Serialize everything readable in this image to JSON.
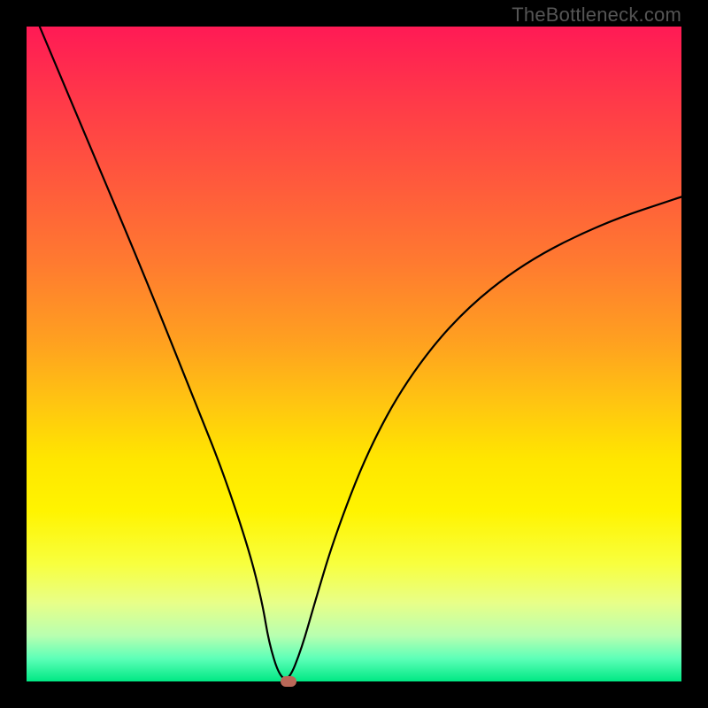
{
  "watermark": "TheBottleneck.com",
  "chart_data": {
    "type": "line",
    "title": "",
    "xlabel": "",
    "ylabel": "",
    "xlim": [
      0,
      100
    ],
    "ylim": [
      0,
      100
    ],
    "series": [
      {
        "name": "curve",
        "x": [
          2,
          10,
          18,
          26,
          30,
          34,
          36,
          37,
          38.5,
          40,
          42,
          44,
          47,
          52,
          58,
          66,
          76,
          88,
          100
        ],
        "values": [
          100,
          81,
          62,
          42,
          32,
          20,
          12,
          6,
          1,
          0,
          5,
          12,
          22,
          35,
          46,
          56,
          64,
          70,
          74
        ]
      }
    ],
    "marker": {
      "x": 40,
      "y": 0
    },
    "background_gradient": {
      "top": "#ff1a55",
      "mid": "#ffe600",
      "bottom": "#00e884"
    },
    "frame_color": "#000000"
  }
}
